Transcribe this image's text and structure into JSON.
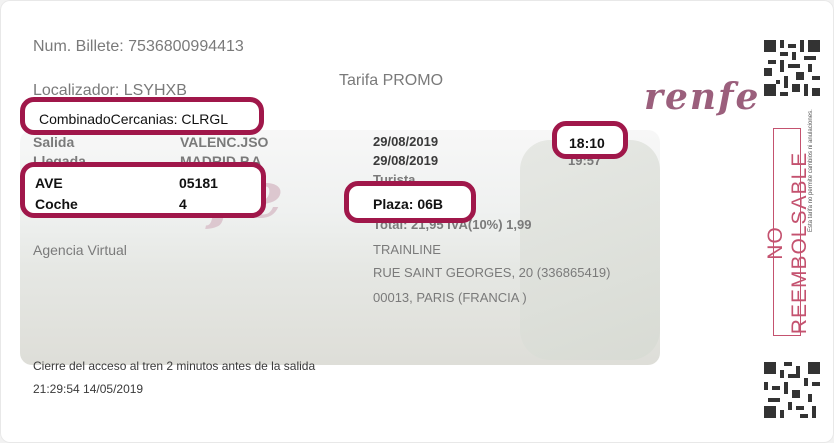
{
  "ticket": {
    "num_billete": "Num. Billete: 7536800994413",
    "localizador": "Localizador: LSYHXB",
    "tarifa": "Tarifa PROMO",
    "logo": "renfe",
    "combinado": "CombinadoCercanias: CLRGL",
    "rows": {
      "salida": {
        "label": "Salida",
        "station": "VALENC.JSO",
        "date": "29/08/2019",
        "time": "18:10"
      },
      "llegada": {
        "label": "Llegada",
        "station": "MADRID P.A",
        "date": "29/08/2019",
        "time": "19:57"
      },
      "train": {
        "label": "AVE",
        "value": "05181",
        "class": "Turista"
      },
      "coche": {
        "label": "Coche",
        "value": "4",
        "plaza": "Plaza: 06B"
      },
      "total": "Total: 21,95 IVA(10%) 1,99"
    },
    "agencia": "Agencia Virtual",
    "address": [
      "TRAINLINE",
      "RUE SAINT GEORGES, 20 (336865419)",
      "00013, PARIS (FRANCIA )"
    ],
    "cierre": "Cierre del acceso al tren 2 minutos antes de la salida",
    "timestamp": "21:29:54 14/05/2019",
    "stamp": "NO REEMBOLSABLE",
    "stamp_note": "Esta tarifa no permite cambios ni anulaciones.",
    "colors": {
      "accent": "#a0174a",
      "stamp": "#c4526f",
      "logo": "#9b5f7c"
    }
  }
}
